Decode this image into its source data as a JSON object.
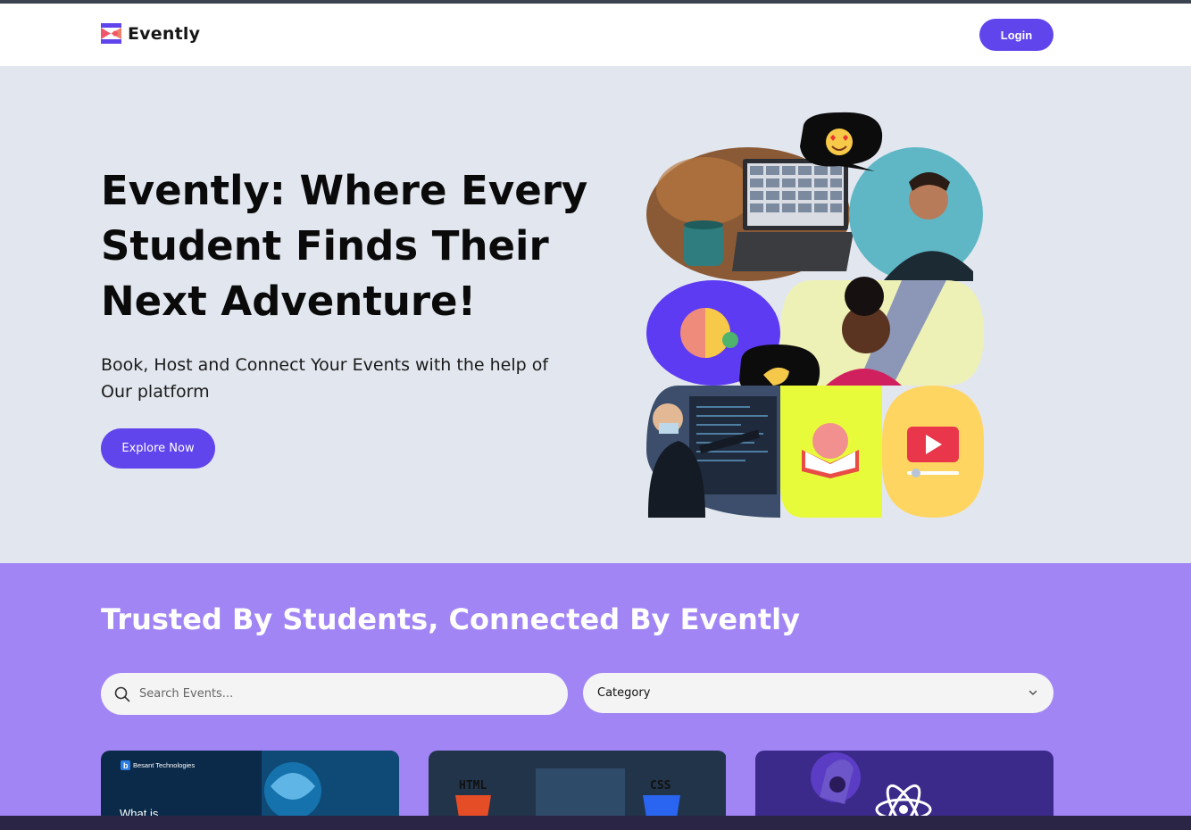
{
  "header": {
    "brand": "Evently",
    "login_label": "Login"
  },
  "hero": {
    "title": "Evently: Where Every Student Finds Their Next Adventure!",
    "subtitle": "Book, Host and Connect Your Events with the help of Our platform",
    "cta_label": "Explore Now"
  },
  "trusted": {
    "title": "Trusted By Students, Connected By Evently",
    "search_placeholder": "Search Events...",
    "category_label": "Category"
  },
  "cards": [
    {
      "brand_text": "Besant Technologies",
      "caption": "What is"
    },
    {
      "left_label": "HTML",
      "right_label": "CSS"
    },
    {}
  ],
  "colors": {
    "accent": "#6145ec",
    "hero_bg": "#e2e7ef",
    "trusted_bg": "#a185f5"
  }
}
